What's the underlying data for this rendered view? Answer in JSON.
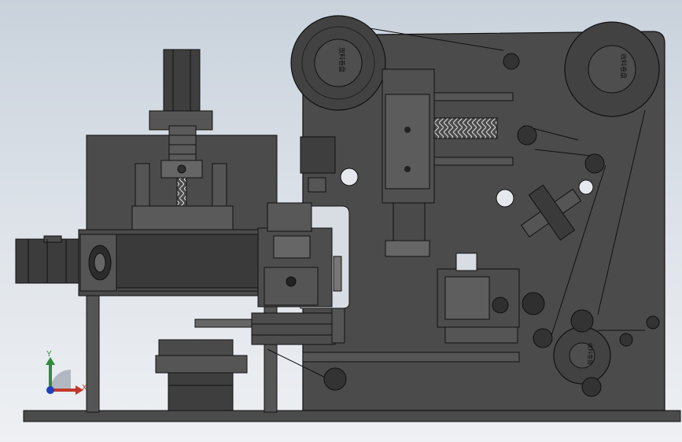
{
  "reel_labels": {
    "left": "放料卷盘",
    "top_right": "收料卷盘",
    "bottom_right": "收料卷盘"
  },
  "axis_triad": {
    "y_label": "Y",
    "x_label": "X",
    "colors": {
      "x": "#c0392b",
      "y": "#2e8b3a",
      "z": "#1f3fbf"
    }
  },
  "colors": {
    "body": "#4b4b4b",
    "body_dark": "#2f2f2f",
    "line": "#111111",
    "background_top": "#c9d2dc"
  }
}
